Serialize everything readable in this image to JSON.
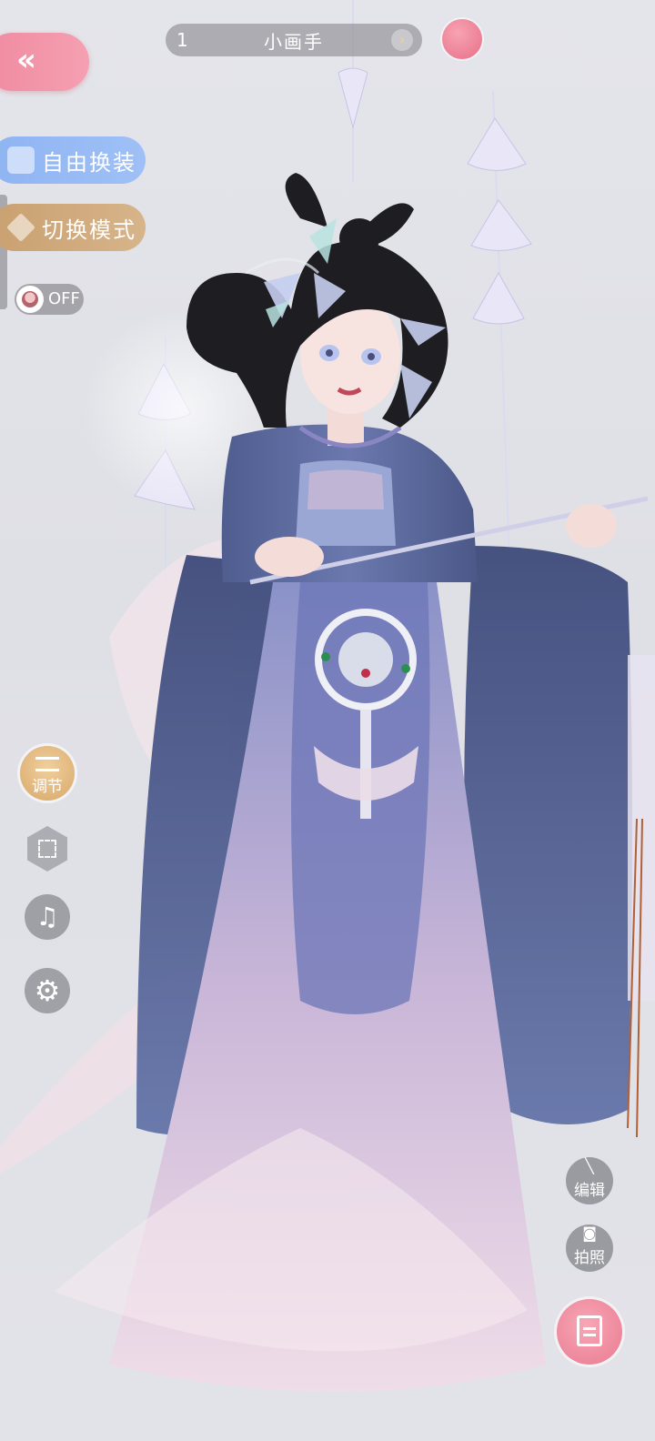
{
  "top_bar": {
    "level": "1",
    "player_name": "小画手",
    "share_icon": "cube-icon"
  },
  "left_menu": {
    "back_icon": "double-chevron-left-icon",
    "free_outfit_label": "自由换装",
    "switch_mode_label": "切换模式",
    "toggle_label": "OFF",
    "adjust_label": "调节",
    "fullscreen_icon": "fullscreen-icon",
    "music_icon": "music-icon",
    "settings_icon": "gear-icon"
  },
  "right_menu": {
    "edit_label": "编辑",
    "photo_label": "拍照",
    "save_icon": "document-icon"
  },
  "colors": {
    "accent_pink": "#ee8399",
    "accent_blue": "#8fb4f3",
    "accent_gold": "#d2aa7c"
  }
}
